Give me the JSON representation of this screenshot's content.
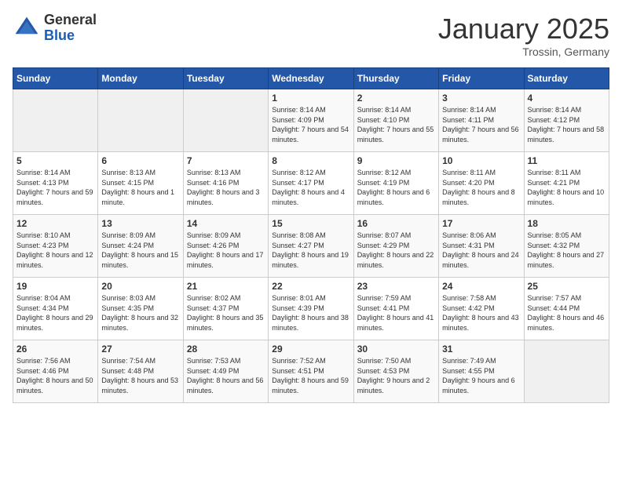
{
  "logo": {
    "general": "General",
    "blue": "Blue"
  },
  "header": {
    "month": "January 2025",
    "location": "Trossin, Germany"
  },
  "weekdays": [
    "Sunday",
    "Monday",
    "Tuesday",
    "Wednesday",
    "Thursday",
    "Friday",
    "Saturday"
  ],
  "weeks": [
    [
      {
        "day": "",
        "sunrise": "",
        "sunset": "",
        "daylight": ""
      },
      {
        "day": "",
        "sunrise": "",
        "sunset": "",
        "daylight": ""
      },
      {
        "day": "",
        "sunrise": "",
        "sunset": "",
        "daylight": ""
      },
      {
        "day": "1",
        "sunrise": "Sunrise: 8:14 AM",
        "sunset": "Sunset: 4:09 PM",
        "daylight": "Daylight: 7 hours and 54 minutes."
      },
      {
        "day": "2",
        "sunrise": "Sunrise: 8:14 AM",
        "sunset": "Sunset: 4:10 PM",
        "daylight": "Daylight: 7 hours and 55 minutes."
      },
      {
        "day": "3",
        "sunrise": "Sunrise: 8:14 AM",
        "sunset": "Sunset: 4:11 PM",
        "daylight": "Daylight: 7 hours and 56 minutes."
      },
      {
        "day": "4",
        "sunrise": "Sunrise: 8:14 AM",
        "sunset": "Sunset: 4:12 PM",
        "daylight": "Daylight: 7 hours and 58 minutes."
      }
    ],
    [
      {
        "day": "5",
        "sunrise": "Sunrise: 8:14 AM",
        "sunset": "Sunset: 4:13 PM",
        "daylight": "Daylight: 7 hours and 59 minutes."
      },
      {
        "day": "6",
        "sunrise": "Sunrise: 8:13 AM",
        "sunset": "Sunset: 4:15 PM",
        "daylight": "Daylight: 8 hours and 1 minute."
      },
      {
        "day": "7",
        "sunrise": "Sunrise: 8:13 AM",
        "sunset": "Sunset: 4:16 PM",
        "daylight": "Daylight: 8 hours and 3 minutes."
      },
      {
        "day": "8",
        "sunrise": "Sunrise: 8:12 AM",
        "sunset": "Sunset: 4:17 PM",
        "daylight": "Daylight: 8 hours and 4 minutes."
      },
      {
        "day": "9",
        "sunrise": "Sunrise: 8:12 AM",
        "sunset": "Sunset: 4:19 PM",
        "daylight": "Daylight: 8 hours and 6 minutes."
      },
      {
        "day": "10",
        "sunrise": "Sunrise: 8:11 AM",
        "sunset": "Sunset: 4:20 PM",
        "daylight": "Daylight: 8 hours and 8 minutes."
      },
      {
        "day": "11",
        "sunrise": "Sunrise: 8:11 AM",
        "sunset": "Sunset: 4:21 PM",
        "daylight": "Daylight: 8 hours and 10 minutes."
      }
    ],
    [
      {
        "day": "12",
        "sunrise": "Sunrise: 8:10 AM",
        "sunset": "Sunset: 4:23 PM",
        "daylight": "Daylight: 8 hours and 12 minutes."
      },
      {
        "day": "13",
        "sunrise": "Sunrise: 8:09 AM",
        "sunset": "Sunset: 4:24 PM",
        "daylight": "Daylight: 8 hours and 15 minutes."
      },
      {
        "day": "14",
        "sunrise": "Sunrise: 8:09 AM",
        "sunset": "Sunset: 4:26 PM",
        "daylight": "Daylight: 8 hours and 17 minutes."
      },
      {
        "day": "15",
        "sunrise": "Sunrise: 8:08 AM",
        "sunset": "Sunset: 4:27 PM",
        "daylight": "Daylight: 8 hours and 19 minutes."
      },
      {
        "day": "16",
        "sunrise": "Sunrise: 8:07 AM",
        "sunset": "Sunset: 4:29 PM",
        "daylight": "Daylight: 8 hours and 22 minutes."
      },
      {
        "day": "17",
        "sunrise": "Sunrise: 8:06 AM",
        "sunset": "Sunset: 4:31 PM",
        "daylight": "Daylight: 8 hours and 24 minutes."
      },
      {
        "day": "18",
        "sunrise": "Sunrise: 8:05 AM",
        "sunset": "Sunset: 4:32 PM",
        "daylight": "Daylight: 8 hours and 27 minutes."
      }
    ],
    [
      {
        "day": "19",
        "sunrise": "Sunrise: 8:04 AM",
        "sunset": "Sunset: 4:34 PM",
        "daylight": "Daylight: 8 hours and 29 minutes."
      },
      {
        "day": "20",
        "sunrise": "Sunrise: 8:03 AM",
        "sunset": "Sunset: 4:35 PM",
        "daylight": "Daylight: 8 hours and 32 minutes."
      },
      {
        "day": "21",
        "sunrise": "Sunrise: 8:02 AM",
        "sunset": "Sunset: 4:37 PM",
        "daylight": "Daylight: 8 hours and 35 minutes."
      },
      {
        "day": "22",
        "sunrise": "Sunrise: 8:01 AM",
        "sunset": "Sunset: 4:39 PM",
        "daylight": "Daylight: 8 hours and 38 minutes."
      },
      {
        "day": "23",
        "sunrise": "Sunrise: 7:59 AM",
        "sunset": "Sunset: 4:41 PM",
        "daylight": "Daylight: 8 hours and 41 minutes."
      },
      {
        "day": "24",
        "sunrise": "Sunrise: 7:58 AM",
        "sunset": "Sunset: 4:42 PM",
        "daylight": "Daylight: 8 hours and 43 minutes."
      },
      {
        "day": "25",
        "sunrise": "Sunrise: 7:57 AM",
        "sunset": "Sunset: 4:44 PM",
        "daylight": "Daylight: 8 hours and 46 minutes."
      }
    ],
    [
      {
        "day": "26",
        "sunrise": "Sunrise: 7:56 AM",
        "sunset": "Sunset: 4:46 PM",
        "daylight": "Daylight: 8 hours and 50 minutes."
      },
      {
        "day": "27",
        "sunrise": "Sunrise: 7:54 AM",
        "sunset": "Sunset: 4:48 PM",
        "daylight": "Daylight: 8 hours and 53 minutes."
      },
      {
        "day": "28",
        "sunrise": "Sunrise: 7:53 AM",
        "sunset": "Sunset: 4:49 PM",
        "daylight": "Daylight: 8 hours and 56 minutes."
      },
      {
        "day": "29",
        "sunrise": "Sunrise: 7:52 AM",
        "sunset": "Sunset: 4:51 PM",
        "daylight": "Daylight: 8 hours and 59 minutes."
      },
      {
        "day": "30",
        "sunrise": "Sunrise: 7:50 AM",
        "sunset": "Sunset: 4:53 PM",
        "daylight": "Daylight: 9 hours and 2 minutes."
      },
      {
        "day": "31",
        "sunrise": "Sunrise: 7:49 AM",
        "sunset": "Sunset: 4:55 PM",
        "daylight": "Daylight: 9 hours and 6 minutes."
      },
      {
        "day": "",
        "sunrise": "",
        "sunset": "",
        "daylight": ""
      }
    ]
  ]
}
